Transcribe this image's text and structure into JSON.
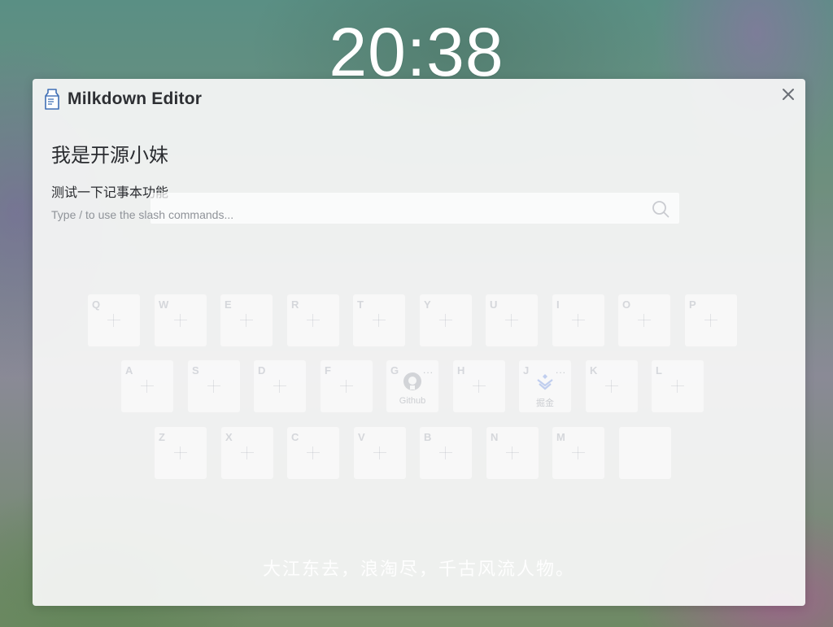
{
  "clock": {
    "time": "20:38"
  },
  "window": {
    "title": "Milkdown Editor",
    "icon": "milk-carton-icon",
    "close_icon": "close-icon"
  },
  "editor": {
    "heading": "我是开源小妹",
    "line": "测试一下记事本功能",
    "placeholder": "Type / to use the slash commands..."
  },
  "search": {
    "icon": "search-icon",
    "value": ""
  },
  "keyboard": {
    "rows": [
      {
        "keys": [
          {
            "letter": "Q"
          },
          {
            "letter": "W"
          },
          {
            "letter": "E"
          },
          {
            "letter": "R"
          },
          {
            "letter": "T"
          },
          {
            "letter": "Y"
          },
          {
            "letter": "U"
          },
          {
            "letter": "I"
          },
          {
            "letter": "O"
          },
          {
            "letter": "P"
          }
        ]
      },
      {
        "keys": [
          {
            "letter": "A"
          },
          {
            "letter": "S"
          },
          {
            "letter": "D"
          },
          {
            "letter": "F"
          },
          {
            "letter": "G",
            "caption": "Github",
            "icon": "github-icon",
            "menu": "..."
          },
          {
            "letter": "H"
          },
          {
            "letter": "J",
            "caption": "掘金",
            "icon": "juejin-icon",
            "menu": "..."
          },
          {
            "letter": "K"
          },
          {
            "letter": "L"
          }
        ]
      },
      {
        "keys": [
          {
            "letter": "Z"
          },
          {
            "letter": "X"
          },
          {
            "letter": "C"
          },
          {
            "letter": "V"
          },
          {
            "letter": "B"
          },
          {
            "letter": "N"
          },
          {
            "letter": "M"
          },
          {
            "letter": ""
          }
        ]
      }
    ]
  },
  "quote": {
    "text": "大江东去，浪淘尽，千古风流人物。"
  },
  "colors": {
    "title": "#2d2f33",
    "panel": "#f7f7f8",
    "placeholder": "#8f9399"
  }
}
